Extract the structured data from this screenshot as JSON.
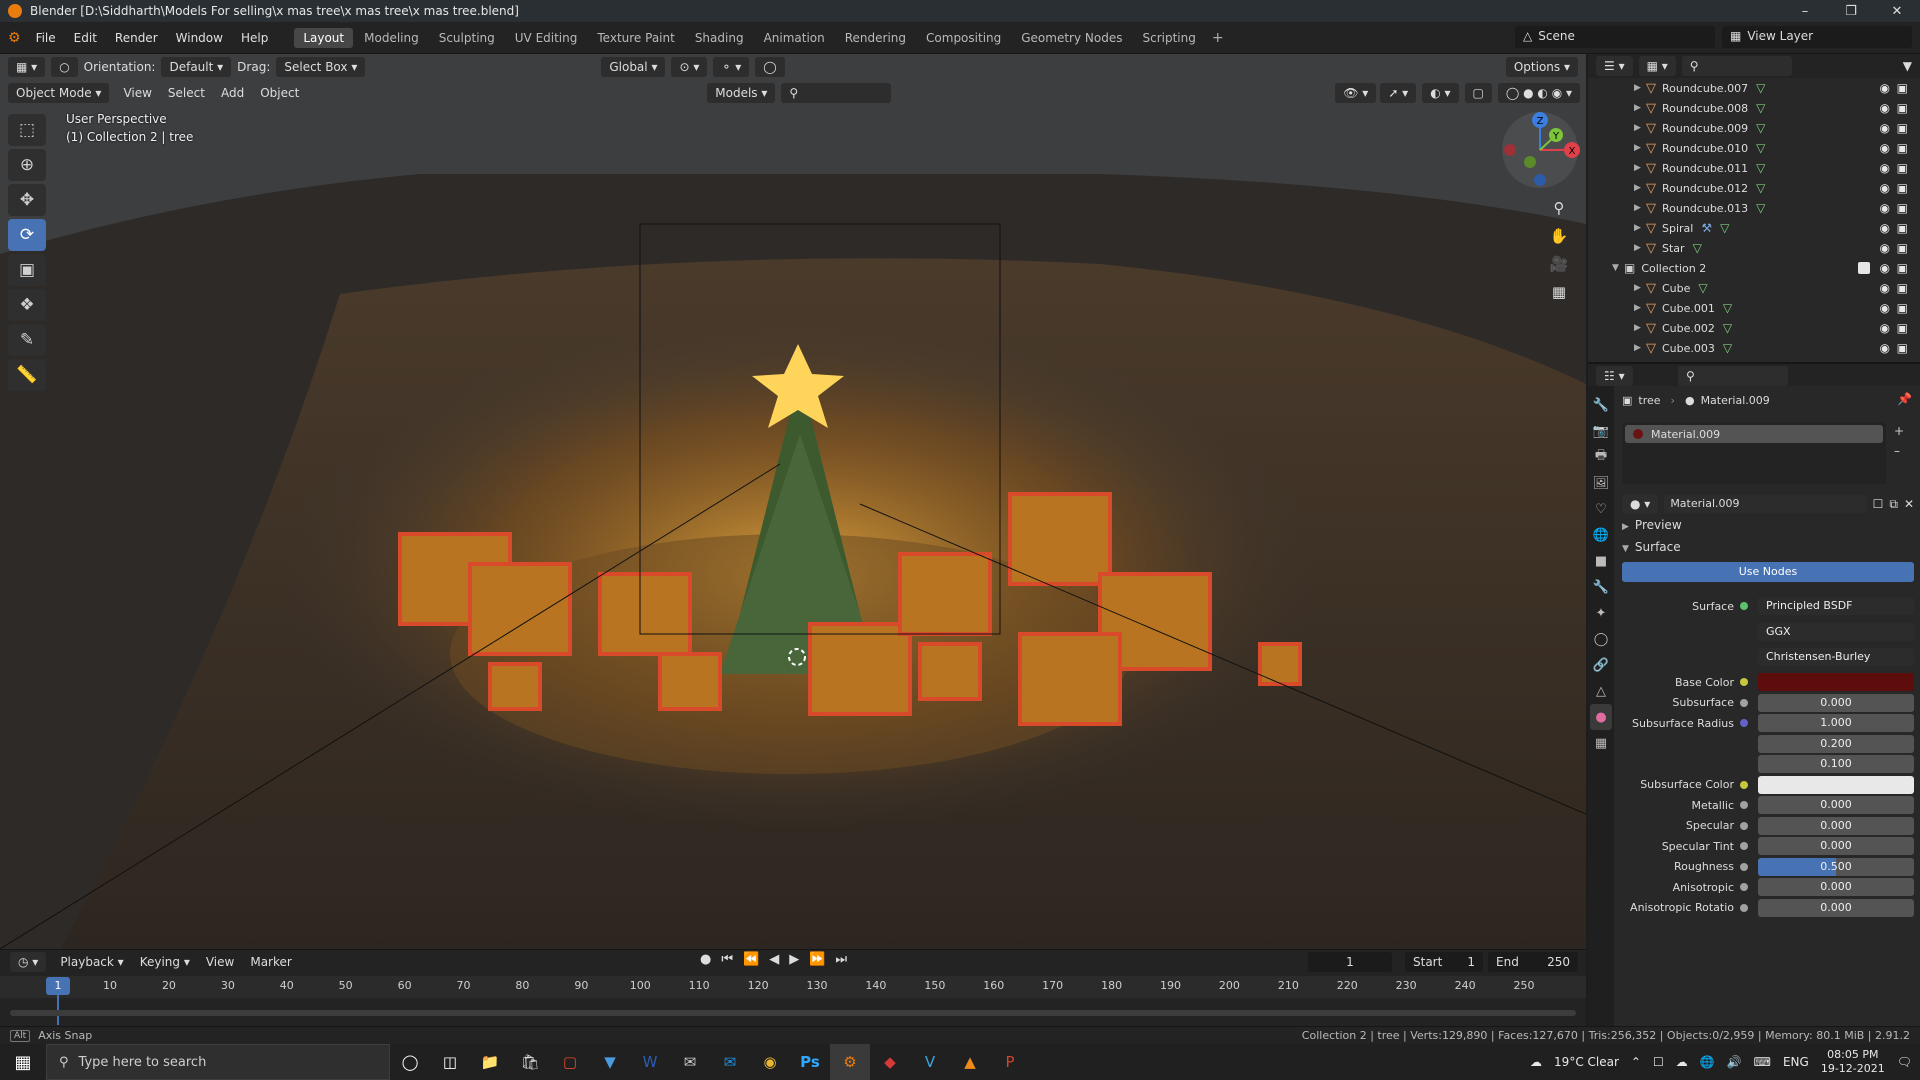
{
  "window": {
    "title": "Blender [D:\\Siddharth\\Models For selling\\x mas tree\\x mas tree\\x mas tree.blend]"
  },
  "topmenu": [
    "File",
    "Edit",
    "Render",
    "Window",
    "Help"
  ],
  "workspaces": [
    "Layout",
    "Modeling",
    "Sculpting",
    "UV Editing",
    "Texture Paint",
    "Shading",
    "Animation",
    "Rendering",
    "Compositing",
    "Geometry Nodes",
    "Scripting"
  ],
  "scene": "Scene",
  "view_layer": "View Layer",
  "viewport": {
    "orientation_label": "Orientation:",
    "orientation_value": "Default",
    "drag_label": "Drag:",
    "drag_value": "Select Box",
    "transform_space": "Global",
    "options": "Options",
    "mode": "Object Mode",
    "menus": [
      "View",
      "Select",
      "Add",
      "Object"
    ],
    "collection_filter": "Models",
    "info_line1": "User Perspective",
    "info_line2": "(1) Collection 2 | tree"
  },
  "gizmo": {
    "x": "X",
    "y": "Y",
    "z": "Z"
  },
  "outliner": {
    "rows": [
      {
        "name": "Roundcube.007",
        "type": "object"
      },
      {
        "name": "Roundcube.008",
        "type": "object"
      },
      {
        "name": "Roundcube.009",
        "type": "object"
      },
      {
        "name": "Roundcube.010",
        "type": "object"
      },
      {
        "name": "Roundcube.011",
        "type": "object"
      },
      {
        "name": "Roundcube.012",
        "type": "object"
      },
      {
        "name": "Roundcube.013",
        "type": "object"
      },
      {
        "name": "Spiral",
        "type": "object"
      },
      {
        "name": "Star",
        "type": "object"
      },
      {
        "name": "Collection 2",
        "type": "collection"
      },
      {
        "name": "Cube",
        "type": "object"
      },
      {
        "name": "Cube.001",
        "type": "object"
      },
      {
        "name": "Cube.002",
        "type": "object"
      },
      {
        "name": "Cube.003",
        "type": "object"
      }
    ]
  },
  "properties": {
    "breadcrumb_object": "tree",
    "breadcrumb_material": "Material.009",
    "slot": "Material.009",
    "material_name": "Material.009",
    "preview": "Preview",
    "surface_panel": "Surface",
    "use_nodes": "Use Nodes",
    "surface_label": "Surface",
    "surface_value": "Principled BSDF",
    "distribution": "GGX",
    "subsurface_method": "Christensen-Burley",
    "fields": [
      {
        "label": "Base Color",
        "value": "",
        "kind": "color",
        "color": "#5e0d0d"
      },
      {
        "label": "Subsurface",
        "value": "0.000",
        "kind": "num"
      },
      {
        "label": "Subsurface Radius",
        "value": "1.000",
        "kind": "num"
      },
      {
        "label": "",
        "value": "0.200",
        "kind": "num"
      },
      {
        "label": "",
        "value": "0.100",
        "kind": "num"
      },
      {
        "label": "Subsurface Color",
        "value": "",
        "kind": "color",
        "color": "#e8e8e8"
      },
      {
        "label": "Metallic",
        "value": "0.000",
        "kind": "num"
      },
      {
        "label": "Specular",
        "value": "0.000",
        "kind": "num"
      },
      {
        "label": "Specular Tint",
        "value": "0.000",
        "kind": "num"
      },
      {
        "label": "Roughness",
        "value": "0.500",
        "kind": "slider",
        "fraction": 0.5
      },
      {
        "label": "Anisotropic",
        "value": "0.000",
        "kind": "num"
      },
      {
        "label": "Anisotropic Rotatio",
        "value": "0.000",
        "kind": "num"
      }
    ]
  },
  "timeline": {
    "menus": [
      "Playback",
      "Keying",
      "View",
      "Marker"
    ],
    "current_frame": "1",
    "start_label": "Start",
    "start_value": "1",
    "end_label": "End",
    "end_value": "250",
    "ticks": [
      "1",
      "10",
      "20",
      "30",
      "40",
      "50",
      "60",
      "70",
      "80",
      "90",
      "100",
      "110",
      "120",
      "130",
      "140",
      "150",
      "160",
      "170",
      "180",
      "190",
      "200",
      "210",
      "220",
      "230",
      "240",
      "250"
    ]
  },
  "statusbar": {
    "left": "Axis Snap",
    "right": "Collection 2 | tree | Verts:129,890 | Faces:127,670 | Tris:256,352 | Objects:0/2,959 | Memory: 80.1 MiB | 2.91.2"
  },
  "taskbar": {
    "search_placeholder": "Type here to search",
    "weather": "19°C Clear",
    "language": "ENG",
    "time": "08:05 PM",
    "date": "19-12-2021"
  }
}
